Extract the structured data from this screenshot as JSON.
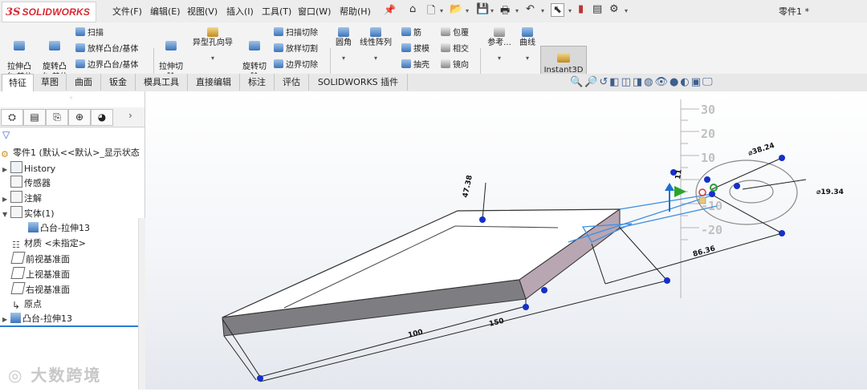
{
  "app": {
    "logo_prefix": "3S",
    "logo_name": "SOLIDWORKS",
    "document_title": "零件1 *"
  },
  "menu": {
    "items": [
      "文件(F)",
      "编辑(E)",
      "视图(V)",
      "插入(I)",
      "工具(T)",
      "窗口(W)",
      "帮助(H)"
    ]
  },
  "commands": {
    "extrude_boss": "拉伸凸\n台/基体",
    "revolve_boss": "旋转凸\n台/基体",
    "sweep": "扫描",
    "loft_boss": "放样凸台/基体",
    "boundary_boss": "边界凸台/基体",
    "extrude_cut": "拉伸切\n除",
    "hole_wizard": "异型孔向导",
    "revolve_cut": "旋转切\n除",
    "sweep_cut": "扫描切除",
    "loft_cut": "放样切割",
    "boundary_cut": "边界切除",
    "fillet": "圆角",
    "linear_pattern": "线性阵列",
    "rib": "筋",
    "draft": "拔模",
    "shell": "抽壳",
    "wrap": "包覆",
    "intersect": "相交",
    "mirror": "镜向",
    "reference": "参考...",
    "curves": "曲线",
    "instant3d": "Instant3D"
  },
  "tabs": [
    "特征",
    "草图",
    "曲面",
    "钣金",
    "模具工具",
    "直接编辑",
    "标注",
    "评估",
    "SOLIDWORKS 插件"
  ],
  "tree": {
    "root": "零件1 (默认<<默认>_显示状态",
    "items": [
      {
        "label": "History",
        "arrow": "▶"
      },
      {
        "label": "传感器",
        "arrow": ""
      },
      {
        "label": "注解",
        "arrow": "▶"
      },
      {
        "label": "实体(1)",
        "arrow": "▼"
      },
      {
        "label": "凸台-拉伸13",
        "arrow": ""
      },
      {
        "label": "材质 <未指定>",
        "arrow": ""
      },
      {
        "label": "前视基准面",
        "arrow": ""
      },
      {
        "label": "上视基准面",
        "arrow": ""
      },
      {
        "label": "右视基准面",
        "arrow": ""
      },
      {
        "label": "原点",
        "arrow": ""
      },
      {
        "label": "凸台-拉伸13",
        "arrow": "▶"
      }
    ]
  },
  "viewport": {
    "dimensions": {
      "d100": "100",
      "d150": "150",
      "d86": "86.36",
      "dia1": "⌀19.34",
      "dia2": "⌀38.24",
      "d47": "47.38",
      "d11": "11"
    },
    "ruler_labels": [
      "30",
      "20",
      "10",
      "-10",
      "-20"
    ],
    "watermark": "大数跨境"
  },
  "colors": {
    "accent": "#2b7cd3",
    "sketch_blue": "#3f8fe0",
    "side_face": "#b9a6b3",
    "logo_red": "#d8282f",
    "dim_point": "#1530c8"
  }
}
